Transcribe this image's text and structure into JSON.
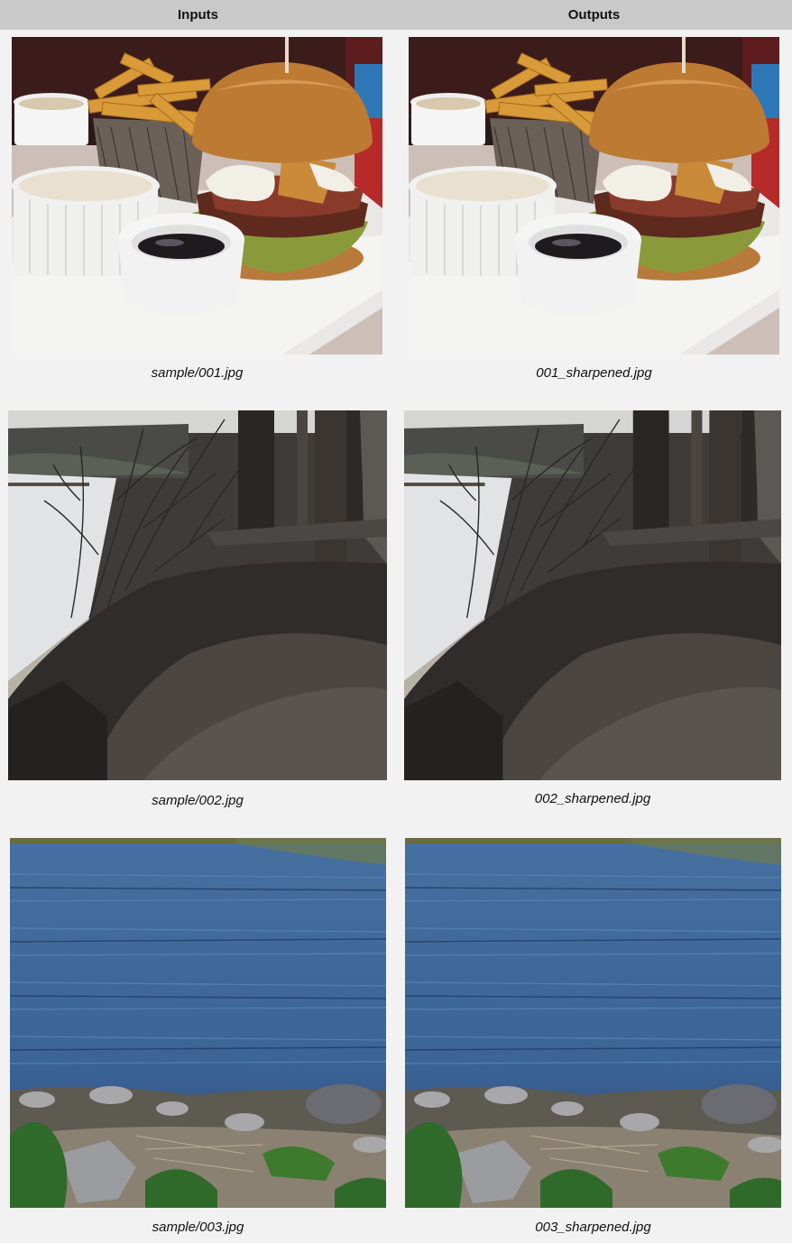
{
  "header": {
    "inputs_label": "Inputs",
    "outputs_label": "Outputs"
  },
  "rows": [
    {
      "input_caption": "sample/001.jpg",
      "output_caption": "001_sharpened.jpg"
    },
    {
      "input_caption": "sample/002.jpg",
      "output_caption": "002_sharpened.jpg"
    },
    {
      "input_caption": "sample/003.jpg",
      "output_caption": "003_sharpened.jpg"
    }
  ]
}
